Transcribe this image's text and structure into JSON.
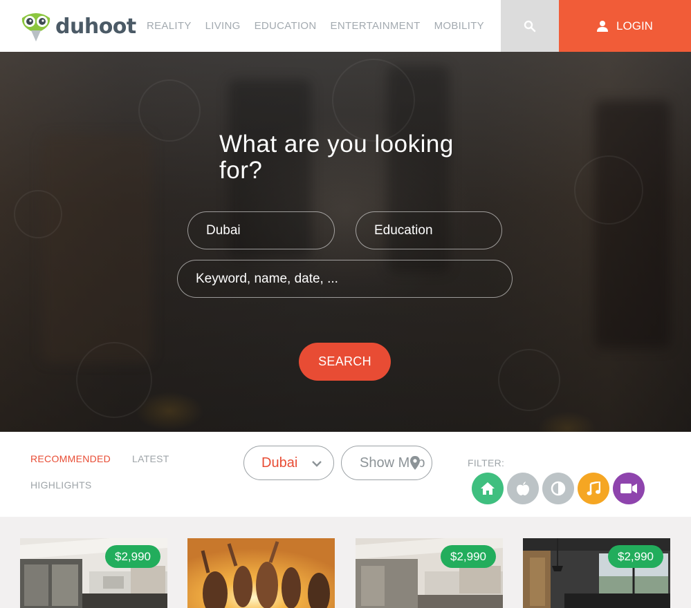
{
  "brand": {
    "name": "duhoot"
  },
  "nav": {
    "items": [
      "REALITY",
      "LIVING",
      "EDUCATION",
      "ENTERTAINMENT",
      "MOBILITY"
    ],
    "login_label": "LOGIN"
  },
  "hero": {
    "title": "What are you looking for?",
    "location_value": "Dubai",
    "category_value": "Education",
    "keyword_placeholder": "Keyword, name, date, ...",
    "search_label": "SEARCH"
  },
  "filters": {
    "tabs": [
      "RECOMMENDED",
      "LATEST",
      "HIGHLIGHTS"
    ],
    "active_tab": "RECOMMENDED",
    "city": "Dubai",
    "show_map_label": "Show Map",
    "filter_label": "FILTER:",
    "categories": [
      {
        "icon": "home-icon",
        "color": "#3fbf7f"
      },
      {
        "icon": "apple-icon",
        "color": "#bcc3c6"
      },
      {
        "icon": "contrast-icon",
        "color": "#bcc3c6"
      },
      {
        "icon": "music-icon",
        "color": "#f5a623"
      },
      {
        "icon": "video-camera-icon",
        "color": "#8e44ad"
      }
    ]
  },
  "listings": [
    {
      "price": "$2,990"
    },
    {
      "price": ""
    },
    {
      "price": "$2,990"
    },
    {
      "price": "$2,990"
    }
  ],
  "colors": {
    "accent": "#f15c38",
    "search": "#e84c34",
    "price": "#22ad5c"
  }
}
